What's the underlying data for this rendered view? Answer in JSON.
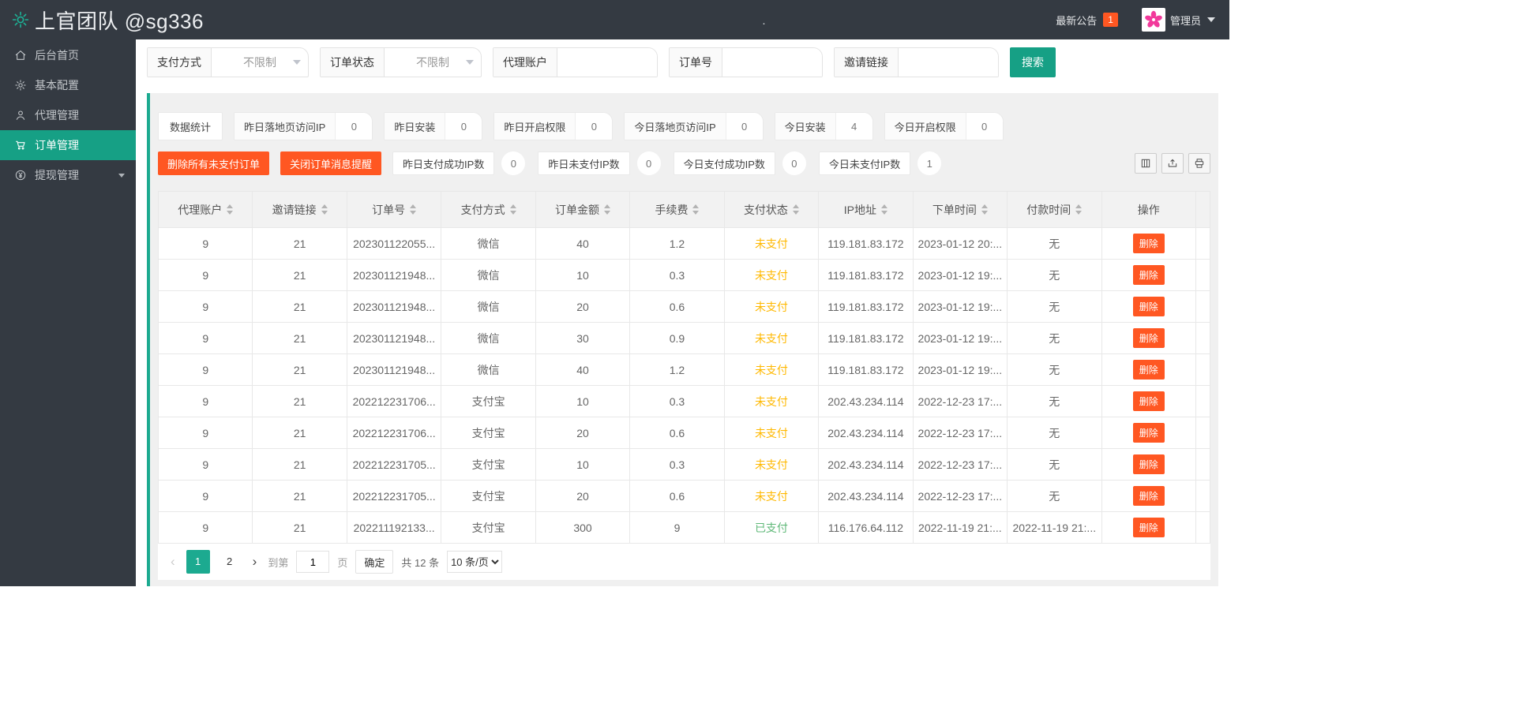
{
  "colors": {
    "dark": "#343a42",
    "accent": "#16a085",
    "accent_light": "#1caa90",
    "danger": "#ff5722",
    "warning": "#ffb800",
    "success": "#5fb878",
    "panel_bg": "#f0f0f0",
    "border": "#e6e6e6"
  },
  "header": {
    "logo_text": "上官团队 @sg336",
    "center_dot": ".",
    "announcement_label": "最新公告",
    "announcement_count": "1",
    "user_name": "管理员"
  },
  "sidebar": {
    "items": [
      {
        "label": "后台首页"
      },
      {
        "label": "基本配置"
      },
      {
        "label": "代理管理"
      },
      {
        "label": "订单管理"
      },
      {
        "label": "提现管理"
      }
    ]
  },
  "filters": {
    "payment_method_label": "支付方式",
    "payment_method_value": "不限制",
    "order_status_label": "订单状态",
    "order_status_value": "不限制",
    "agent_account_label": "代理账户",
    "agent_account_value": "",
    "order_no_label": "订单号",
    "order_no_value": "",
    "invite_link_label": "邀请链接",
    "invite_link_value": "",
    "search_button": "搜索"
  },
  "stats": {
    "title": "数据统计",
    "items": [
      {
        "label": "昨日落地页访问IP",
        "value": "0"
      },
      {
        "label": "昨日安装",
        "value": "0"
      },
      {
        "label": "昨日开启权限",
        "value": "0"
      },
      {
        "label": "今日落地页访问IP",
        "value": "0"
      },
      {
        "label": "今日安装",
        "value": "4"
      },
      {
        "label": "今日开启权限",
        "value": "0"
      }
    ]
  },
  "actions": {
    "delete_unpaid_button": "删除所有未支付订单",
    "close_notify_button": "关闭订单消息提醒",
    "stats": [
      {
        "label": "昨日支付成功IP数",
        "value": "0"
      },
      {
        "label": "昨日未支付IP数",
        "value": "0"
      },
      {
        "label": "今日支付成功IP数",
        "value": "0"
      },
      {
        "label": "今日未支付IP数",
        "value": "1"
      }
    ]
  },
  "table": {
    "columns": [
      {
        "label": "代理账户",
        "sortable": true
      },
      {
        "label": "邀请链接",
        "sortable": true
      },
      {
        "label": "订单号",
        "sortable": true
      },
      {
        "label": "支付方式",
        "sortable": true
      },
      {
        "label": "订单金额",
        "sortable": true
      },
      {
        "label": "手续费",
        "sortable": true
      },
      {
        "label": "支付状态",
        "sortable": true
      },
      {
        "label": "IP地址",
        "sortable": true
      },
      {
        "label": "下单时间",
        "sortable": true
      },
      {
        "label": "付款时间",
        "sortable": true
      },
      {
        "label": "操作",
        "sortable": false
      },
      {
        "label": "",
        "sortable": false,
        "extra_class": "filler"
      }
    ],
    "delete_label": "删除",
    "rows": [
      {
        "agent": "9",
        "invite_link": "21",
        "order_no": "202301122055...",
        "method": "微信",
        "amount": "40",
        "fee": "1.2",
        "status": "未支付",
        "status_type": "unpaid",
        "ip": "119.181.83.172",
        "order_time": "2023-01-12 20:...",
        "pay_time": "无"
      },
      {
        "agent": "9",
        "invite_link": "21",
        "order_no": "202301121948...",
        "method": "微信",
        "amount": "10",
        "fee": "0.3",
        "status": "未支付",
        "status_type": "unpaid",
        "ip": "119.181.83.172",
        "order_time": "2023-01-12 19:...",
        "pay_time": "无"
      },
      {
        "agent": "9",
        "invite_link": "21",
        "order_no": "202301121948...",
        "method": "微信",
        "amount": "20",
        "fee": "0.6",
        "status": "未支付",
        "status_type": "unpaid",
        "ip": "119.181.83.172",
        "order_time": "2023-01-12 19:...",
        "pay_time": "无"
      },
      {
        "agent": "9",
        "invite_link": "21",
        "order_no": "202301121948...",
        "method": "微信",
        "amount": "30",
        "fee": "0.9",
        "status": "未支付",
        "status_type": "unpaid",
        "ip": "119.181.83.172",
        "order_time": "2023-01-12 19:...",
        "pay_time": "无"
      },
      {
        "agent": "9",
        "invite_link": "21",
        "order_no": "202301121948...",
        "method": "微信",
        "amount": "40",
        "fee": "1.2",
        "status": "未支付",
        "status_type": "unpaid",
        "ip": "119.181.83.172",
        "order_time": "2023-01-12 19:...",
        "pay_time": "无"
      },
      {
        "agent": "9",
        "invite_link": "21",
        "order_no": "202212231706...",
        "method": "支付宝",
        "amount": "10",
        "fee": "0.3",
        "status": "未支付",
        "status_type": "unpaid",
        "ip": "202.43.234.114",
        "order_time": "2022-12-23 17:...",
        "pay_time": "无"
      },
      {
        "agent": "9",
        "invite_link": "21",
        "order_no": "202212231706...",
        "method": "支付宝",
        "amount": "20",
        "fee": "0.6",
        "status": "未支付",
        "status_type": "unpaid",
        "ip": "202.43.234.114",
        "order_time": "2022-12-23 17:...",
        "pay_time": "无"
      },
      {
        "agent": "9",
        "invite_link": "21",
        "order_no": "202212231705...",
        "method": "支付宝",
        "amount": "10",
        "fee": "0.3",
        "status": "未支付",
        "status_type": "unpaid",
        "ip": "202.43.234.114",
        "order_time": "2022-12-23 17:...",
        "pay_time": "无"
      },
      {
        "agent": "9",
        "invite_link": "21",
        "order_no": "202212231705...",
        "method": "支付宝",
        "amount": "20",
        "fee": "0.6",
        "status": "未支付",
        "status_type": "unpaid",
        "ip": "202.43.234.114",
        "order_time": "2022-12-23 17:...",
        "pay_time": "无"
      },
      {
        "agent": "9",
        "invite_link": "21",
        "order_no": "202211192133...",
        "method": "支付宝",
        "amount": "300",
        "fee": "9",
        "status": "已支付",
        "status_type": "paid",
        "ip": "116.176.64.112",
        "order_time": "2022-11-19 21:...",
        "pay_time": "2022-11-19 21:..."
      }
    ]
  },
  "pagination": {
    "prev": "‹",
    "next": "›",
    "pages": [
      "1",
      "2"
    ],
    "active_page": "1",
    "goto_label": "到第",
    "goto_value": "1",
    "page_unit": "页",
    "confirm_button": "确定",
    "total_text": "共 12 条",
    "per_page": "10 条/页"
  }
}
